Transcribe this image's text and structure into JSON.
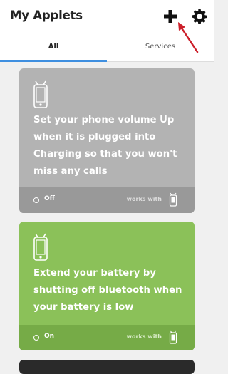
{
  "header": {
    "title": "My Applets",
    "add_icon": "plus-icon",
    "settings_icon": "gear-icon"
  },
  "tabs": [
    {
      "label": "All",
      "active": true
    },
    {
      "label": "Services",
      "active": false
    }
  ],
  "applets": [
    {
      "icon": "android-phone-icon",
      "text": "Set your phone volume Up when it is plugged into Charging so that you won't miss any calls",
      "status": "Off",
      "works_with_label": "works with",
      "works_with_icon": "android-phone-icon",
      "color": "#b3b3b3"
    },
    {
      "icon": "android-phone-icon",
      "text": "Extend your battery by shutting off bluetooth when your battery is low",
      "status": "On",
      "works_with_label": "works with",
      "works_with_icon": "android-phone-icon",
      "color": "#8bc159"
    }
  ],
  "colors": {
    "accent": "#3f8fe0",
    "annotation_arrow": "#cc1f2a",
    "applet_off": "#b3b3b3",
    "applet_on": "#8bc159"
  }
}
